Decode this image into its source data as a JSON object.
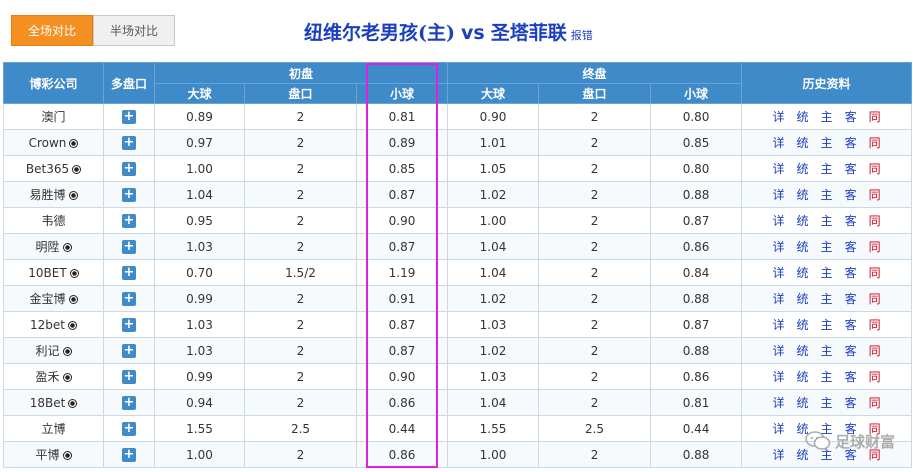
{
  "tabs": {
    "full_match": "全场对比",
    "half_match": "半场对比"
  },
  "match": {
    "home": "纽维尔老男孩(主)",
    "vs": "vs",
    "away": "圣塔菲联",
    "report": "报错"
  },
  "table": {
    "header": {
      "company": "博彩公司",
      "multi": "多盘口",
      "initial": "初盘",
      "final": "终盘",
      "history": "历史资料",
      "over": "大球",
      "line": "盘口",
      "under": "小球"
    },
    "rows": [
      {
        "company": "澳门",
        "ball": false,
        "init_over": "0.89",
        "init_line": "2",
        "init_under": "0.81",
        "fin_over": "0.90",
        "fin_line": "2",
        "fin_under": "0.80"
      },
      {
        "company": "Crown",
        "ball": true,
        "init_over": "0.97",
        "init_line": "2",
        "init_under": "0.89",
        "fin_over": "1.01",
        "fin_line": "2",
        "fin_under": "0.85"
      },
      {
        "company": "Bet365",
        "ball": true,
        "init_over": "1.00",
        "init_line": "2",
        "init_under": "0.85",
        "fin_over": "1.05",
        "fin_line": "2",
        "fin_under": "0.80"
      },
      {
        "company": "易胜博",
        "ball": true,
        "init_over": "1.04",
        "init_line": "2",
        "init_under": "0.87",
        "fin_over": "1.02",
        "fin_line": "2",
        "fin_under": "0.88"
      },
      {
        "company": "韦德",
        "ball": false,
        "init_over": "0.95",
        "init_line": "2",
        "init_under": "0.90",
        "fin_over": "1.00",
        "fin_line": "2",
        "fin_under": "0.87"
      },
      {
        "company": "明陞",
        "ball": true,
        "init_over": "1.03",
        "init_line": "2",
        "init_under": "0.87",
        "fin_over": "1.04",
        "fin_line": "2",
        "fin_under": "0.86"
      },
      {
        "company": "10BET",
        "ball": true,
        "init_over": "0.70",
        "init_line": "1.5/2",
        "init_under": "1.19",
        "fin_over": "1.04",
        "fin_line": "2",
        "fin_under": "0.84"
      },
      {
        "company": "金宝博",
        "ball": true,
        "init_over": "0.99",
        "init_line": "2",
        "init_under": "0.91",
        "fin_over": "1.02",
        "fin_line": "2",
        "fin_under": "0.88"
      },
      {
        "company": "12bet",
        "ball": true,
        "init_over": "1.03",
        "init_line": "2",
        "init_under": "0.87",
        "fin_over": "1.03",
        "fin_line": "2",
        "fin_under": "0.87"
      },
      {
        "company": "利记",
        "ball": true,
        "init_over": "1.03",
        "init_line": "2",
        "init_under": "0.87",
        "fin_over": "1.02",
        "fin_line": "2",
        "fin_under": "0.88"
      },
      {
        "company": "盈禾",
        "ball": true,
        "init_over": "0.99",
        "init_line": "2",
        "init_under": "0.90",
        "fin_over": "1.03",
        "fin_line": "2",
        "fin_under": "0.86"
      },
      {
        "company": "18Bet",
        "ball": true,
        "init_over": "0.94",
        "init_line": "2",
        "init_under": "0.86",
        "fin_over": "1.04",
        "fin_line": "2",
        "fin_under": "0.81"
      },
      {
        "company": "立博",
        "ball": false,
        "init_over": "1.55",
        "init_line": "2.5",
        "init_under": "0.44",
        "fin_over": "1.55",
        "fin_line": "2.5",
        "fin_under": "0.44"
      },
      {
        "company": "平博",
        "ball": true,
        "init_over": "1.00",
        "init_line": "2",
        "init_under": "0.86",
        "fin_over": "1.00",
        "fin_line": "2",
        "fin_under": "0.88"
      }
    ],
    "history_links": [
      "详",
      "统",
      "主",
      "客",
      "同"
    ]
  },
  "watermark": "足球财富",
  "colors": {
    "tab_active": "#f39021",
    "header_bg": "#3f8ac9",
    "title": "#1b3fc0",
    "highlight": "#e01fe0"
  }
}
